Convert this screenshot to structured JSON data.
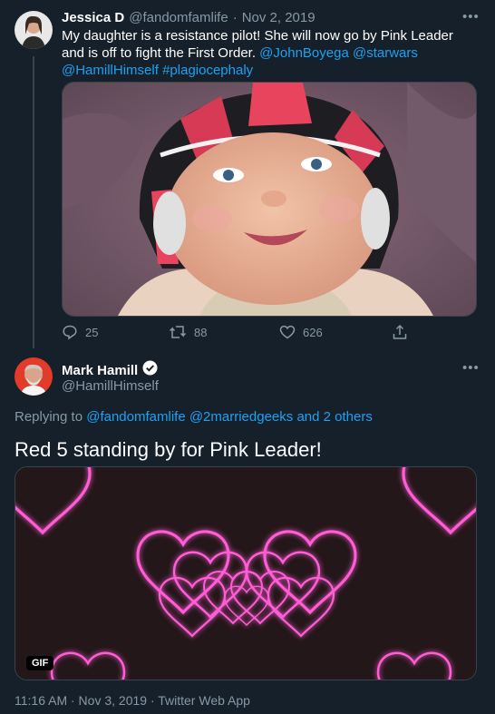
{
  "reply_tweet": {
    "author_name": "Jessica D",
    "author_handle": "@fandomfamlife",
    "separator": "·",
    "date": "Nov 2, 2019",
    "text": "My daughter is a resistance pilot! She will now go by Pink Leader and is off to fight the First Order.",
    "mentions": [
      "@JohnBoyega",
      "@starwars",
      "@HamillHimself"
    ],
    "hashtag": "#plagiocephaly",
    "more_icon": "more-horizontal-icon",
    "stats": {
      "replies": "25",
      "retweets": "88",
      "likes": "626"
    },
    "icons": [
      "reply-icon",
      "retweet-icon",
      "like-icon",
      "share-icon"
    ]
  },
  "main_tweet": {
    "author_name": "Mark Hamill",
    "author_handle": "@HamillHimself",
    "verified_icon": "verified-badge-icon",
    "more_icon": "more-horizontal-icon",
    "replying_prefix": "Replying to",
    "replying_handles": "@fandomfamlife @2marriedgeeks",
    "replying_suffix": "and 2 others",
    "text": "Red 5 standing by for Pink Leader!",
    "gif_badge": "GIF",
    "timestamp": "11:16 AM · Nov 3, 2019 · Twitter Web App"
  },
  "colors": {
    "background": "#15202b",
    "link": "#1da1f2",
    "muted": "#8899a6",
    "border": "#38444d",
    "neon_pink": "#ff5cd6"
  }
}
